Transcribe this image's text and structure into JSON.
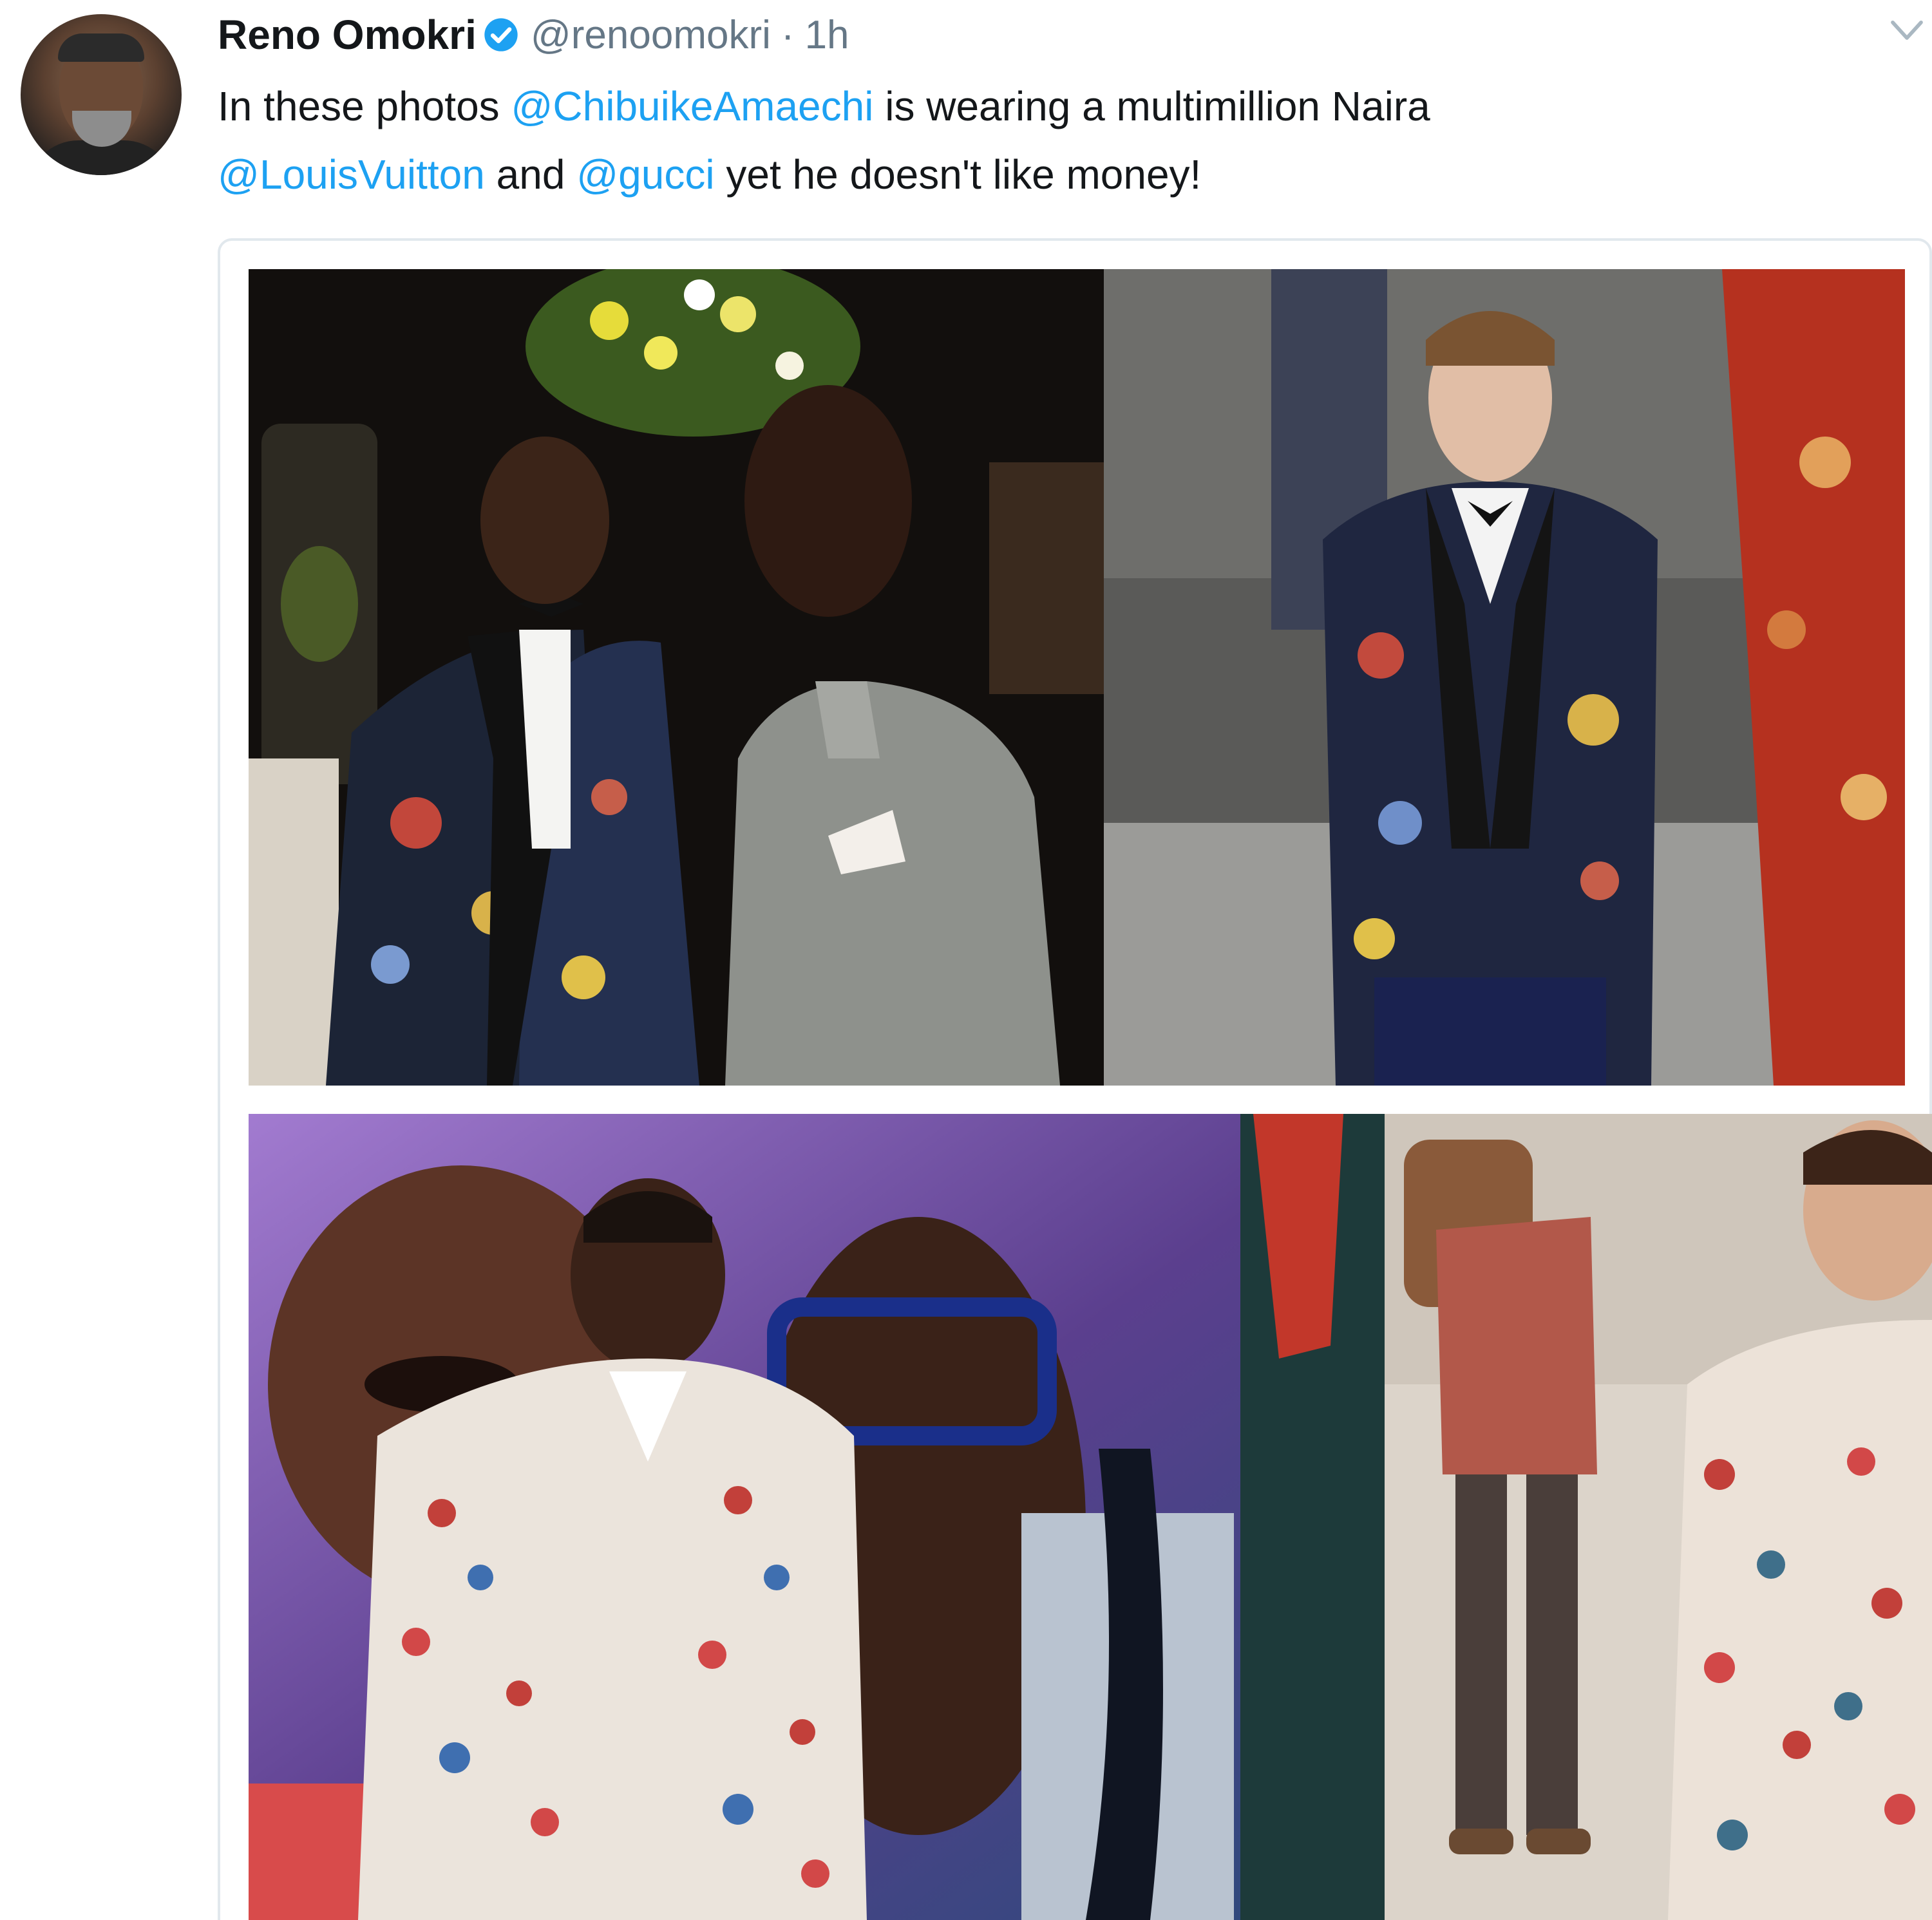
{
  "author": {
    "display_name": "Reno Omokri",
    "handle": "@renoomokri",
    "separator": "·",
    "time": "1h",
    "verified": true,
    "avatar_icon": "profile-photo"
  },
  "tweet": {
    "line1_prefix": "In these photos ",
    "mention1": "@ChibuikeAmaechi",
    "line1_suffix": " is wearing a multimillion Naira",
    "mention2": "@LouisVuitton",
    "and_text": " and ",
    "mention3": "@gucci",
    "line2_suffix": " yet he doesn't like money!"
  },
  "icons": {
    "verified": "verified-badge-icon",
    "more": "chevron-down-icon"
  },
  "colors": {
    "link": "#1da1f2",
    "muted": "#657786",
    "text": "#14171a",
    "verified": "#1da1f2"
  }
}
